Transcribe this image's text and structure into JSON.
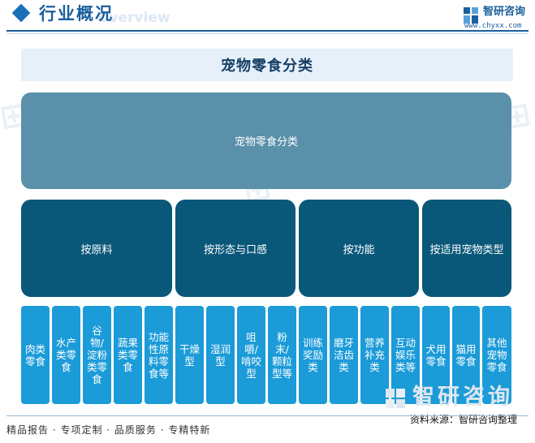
{
  "header": {
    "title": "行业概况",
    "title_en": "Overview",
    "brand_name": "智研咨询",
    "brand_url": "www.chyxx.com"
  },
  "diagram": {
    "title": "宠物零食分类",
    "root": "宠物零食分类",
    "categories": [
      "按原料",
      "按形态与口感",
      "按功能",
      "按适用宠物类型"
    ],
    "leaves": [
      "肉类零食",
      "水产类零食",
      "谷物/淀粉类零食",
      "蔬果类零食",
      "功能性原料零食等",
      "干燥型",
      "湿润型",
      "咀嚼/啃咬型",
      "粉末/颗粒型等",
      "训练奖励类",
      "磨牙洁齿类",
      "营养补充类",
      "互动娱乐类等",
      "犬用零食",
      "猫用零食",
      "其他宠物零食"
    ]
  },
  "footer": {
    "tagline": "精品报告 · 专项定制 · 品质服务 · 专精特新",
    "source": "资料来源：智研咨询整理",
    "watermark": "智研咨询"
  },
  "colors": {
    "brand": "#1b5f9c",
    "root_fill": "#5a90aa",
    "category_fill": "#0a5879",
    "leaf_fill": "#1b9bd8",
    "title_band": "#e6f0f9"
  }
}
